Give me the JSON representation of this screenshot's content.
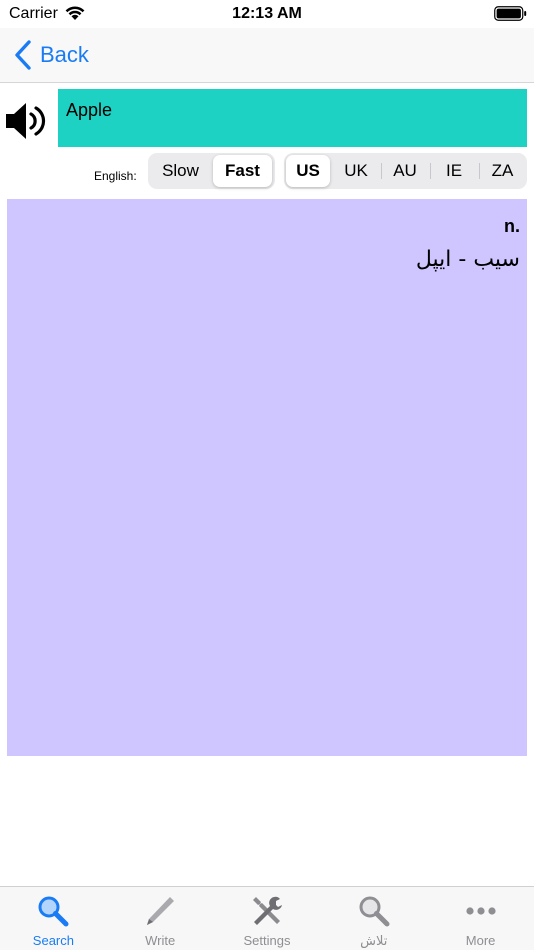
{
  "status": {
    "carrier": "Carrier",
    "time": "12:13 AM"
  },
  "nav": {
    "back_label": "Back"
  },
  "word": {
    "text": "Apple"
  },
  "controls": {
    "english_label": "English:",
    "speed": [
      {
        "label": "Slow",
        "selected": false
      },
      {
        "label": "Fast",
        "selected": true
      }
    ],
    "accents": [
      {
        "label": "US",
        "selected": true
      },
      {
        "label": "UK",
        "selected": false
      },
      {
        "label": "AU",
        "selected": false
      },
      {
        "label": "IE",
        "selected": false
      },
      {
        "label": "ZA",
        "selected": false
      }
    ]
  },
  "definition": {
    "part_of_speech": "n.",
    "meaning": "سیب - ایپل"
  },
  "tabs": [
    {
      "label": "Search",
      "icon": "magnifier-icon",
      "active": true
    },
    {
      "label": "Write",
      "icon": "pencil-icon",
      "active": false
    },
    {
      "label": "Settings",
      "icon": "tools-icon",
      "active": false
    },
    {
      "label": "تلاش",
      "icon": "magnifier-icon",
      "active": false
    },
    {
      "label": "More",
      "icon": "ellipsis-icon",
      "active": false
    }
  ],
  "colors": {
    "accent": "#1a7cf5",
    "word_background": "#1dd1c3",
    "definition_background": "#cfc6ff",
    "tab_inactive": "#8e8e93"
  }
}
